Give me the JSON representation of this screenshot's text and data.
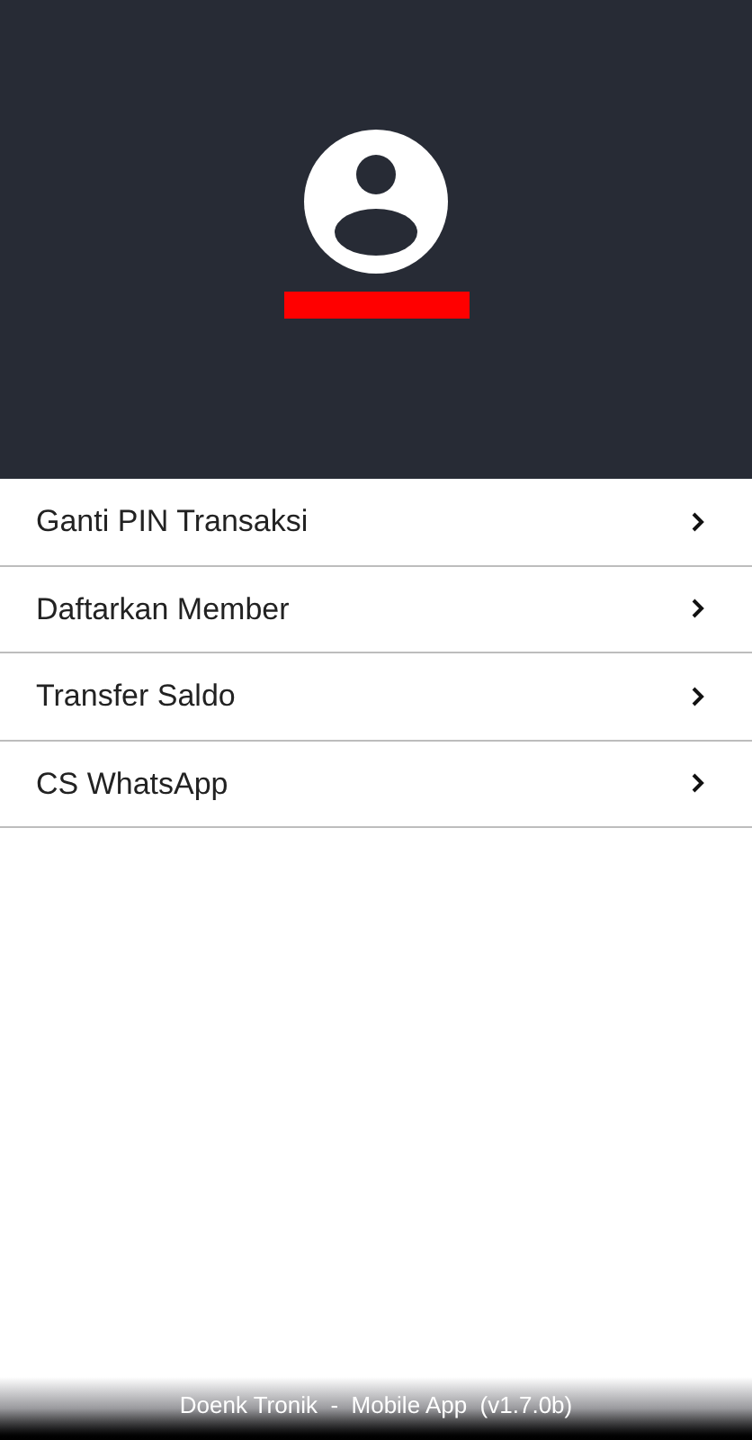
{
  "header": {
    "avatar": true,
    "name_redacted": true
  },
  "menu": [
    {
      "label": "Ganti PIN Transaksi"
    },
    {
      "label": "Daftarkan Member"
    },
    {
      "label": "Transfer Saldo"
    },
    {
      "label": "CS WhatsApp"
    }
  ],
  "footer": "Doenk Tronik  -  Mobile App  (v1.7.0b)"
}
